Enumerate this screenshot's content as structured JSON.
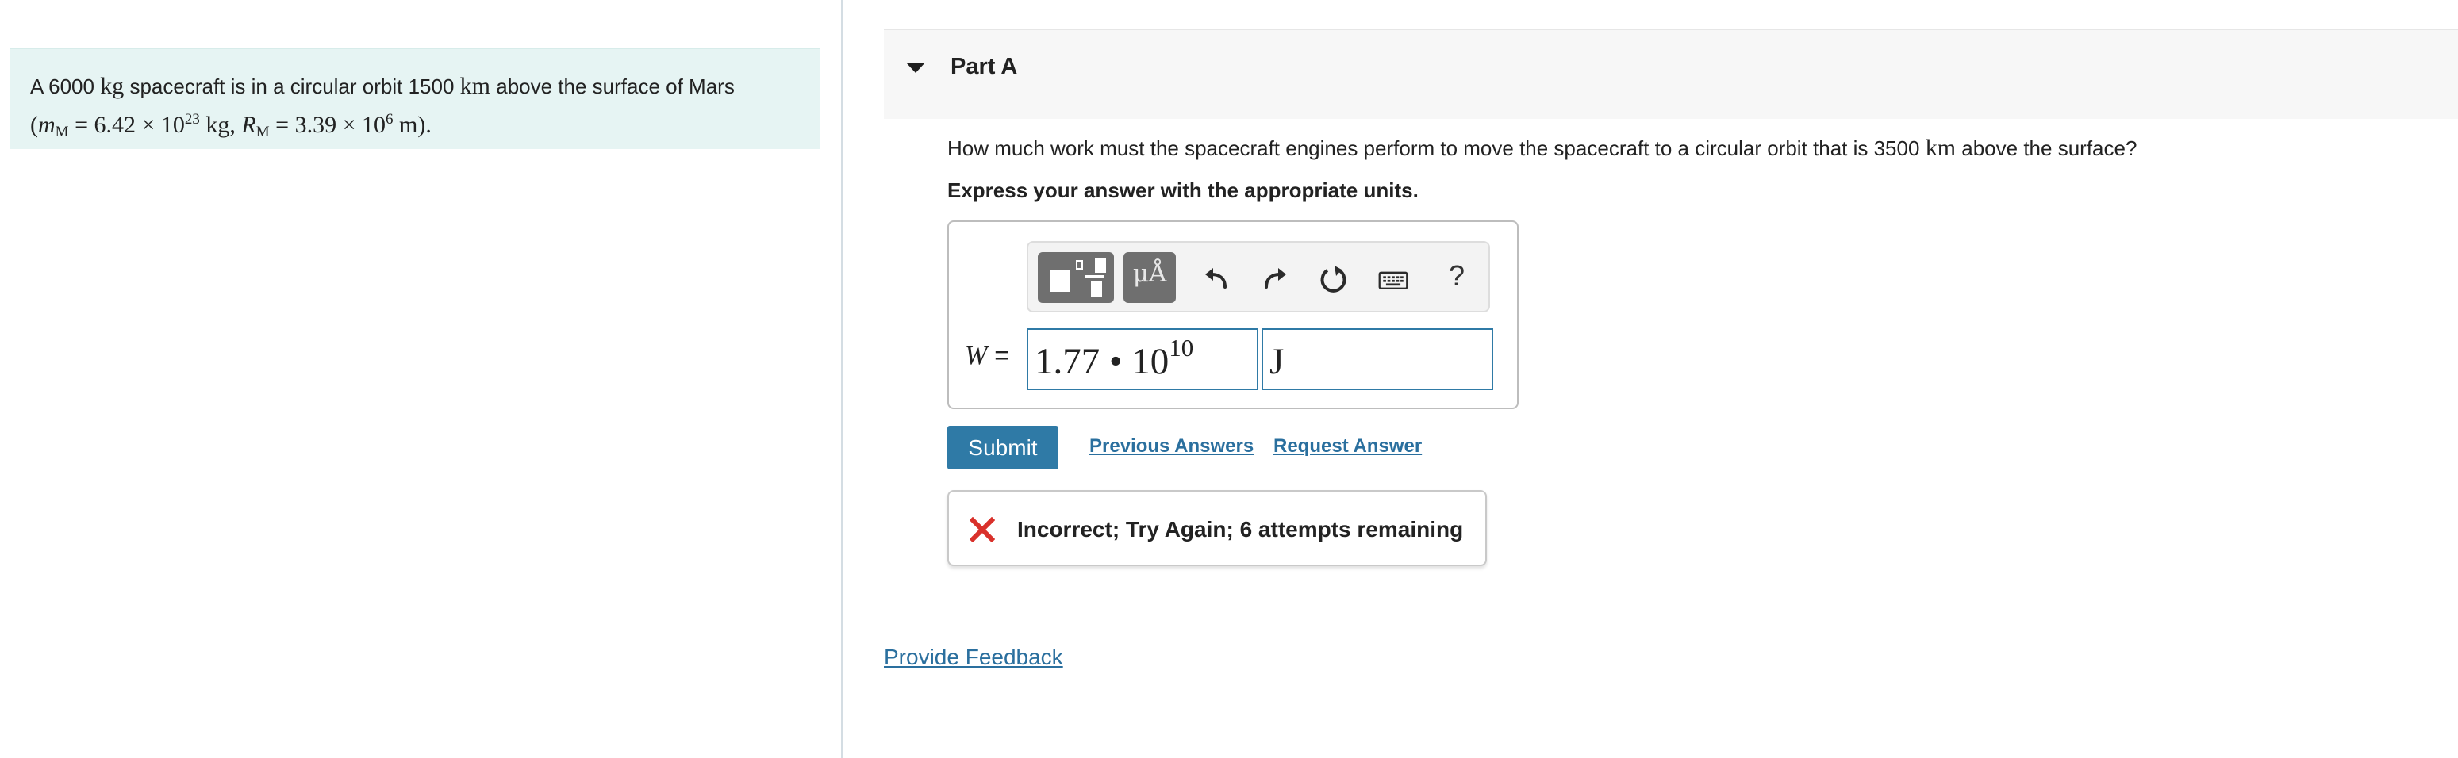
{
  "problem": {
    "text_1": "A 6000",
    "mass_unit": "kg",
    "text_2": "spacecraft is in a circular orbit 1500",
    "distance_unit": "km",
    "text_3": "above the surface of Mars",
    "given_open": "(",
    "mars_mass_symbol": "m",
    "mars_mass_sub": "M",
    "mars_mass_value": "= 6.42 × 10",
    "mars_mass_exp": "23",
    "mars_mass_unit": "kg",
    "sep": ",",
    "mars_radius_symbol": "R",
    "mars_radius_sub": "M",
    "mars_radius_value": "= 3.39 × 10",
    "mars_radius_exp": "6",
    "mars_radius_unit": "m",
    "given_close": ")."
  },
  "part": {
    "title": "Part A",
    "question_1": "How much work must the spacecraft engines perform to move the spacecraft to a circular orbit that is 3500",
    "question_unit": "km",
    "question_2": "above the surface?",
    "instruction": "Express your answer with the appropriate units."
  },
  "toolbar": {
    "units_label": "μÅ",
    "help_label": "?",
    "icons": [
      "templates-icon",
      "units-icon",
      "undo-icon",
      "redo-icon",
      "reset-icon",
      "keyboard-icon",
      "help-icon"
    ]
  },
  "answer": {
    "label_var": "W",
    "label_eq": "=",
    "value_mantissa": "1.77 • 10",
    "value_exp": "10",
    "unit": "J"
  },
  "actions": {
    "submit": "Submit",
    "previous_answers": "Previous Answers",
    "request_answer": "Request Answer"
  },
  "feedback": {
    "message": "Incorrect; Try Again; 6 attempts remaining",
    "status_color": "#d9312b"
  },
  "footer": {
    "provide_feedback": "Provide Feedback"
  },
  "colors": {
    "accent": "#2f7aa6",
    "link": "#2a6f9e",
    "problem_bg": "#e6f4f3"
  }
}
